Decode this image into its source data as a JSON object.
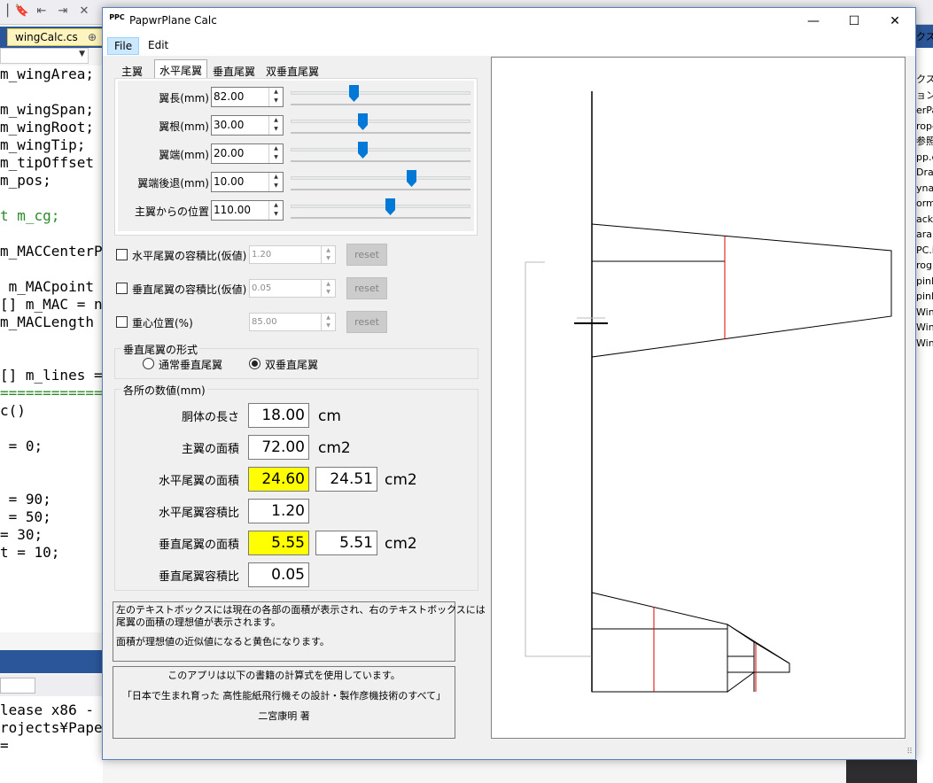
{
  "ide": {
    "tab_label": "wingCalc.cs",
    "tab_pin": "⊕",
    "code_lines": [
      "m_wingArea;",
      "",
      "m_wingSpan;",
      "m_wingRoot;",
      "m_wingTip;",
      "m_tipOffset",
      "m_pos;",
      "",
      "t m_cg;",
      "",
      "m_MACCenterP",
      "",
      " m_MACpoint",
      "[] m_MAC = n",
      "m_MACLength",
      "",
      "",
      "[] m_lines =",
      "============",
      "c()",
      "",
      " = 0;",
      "",
      "",
      " = 90;",
      " = 50;",
      "= 30;",
      "t = 10;"
    ],
    "output_lines": [
      "lease x86 -",
      "rojects¥Pape",
      "="
    ],
    "right_panel_items": [
      "クス",
      "クス",
      "ョン",
      "erPa",
      "rope",
      "参照",
      "pp.c",
      "Draw",
      "ynan",
      "orm",
      "ack",
      "aran",
      "PC.i",
      "rog",
      "pinB",
      "pinB",
      "Wing",
      "Wing",
      "Wing"
    ]
  },
  "app": {
    "icon_text": "PPC",
    "title": "PapwrPlane Calc",
    "window_controls": {
      "minimize": "—",
      "maximize": "☐",
      "close": "✕"
    },
    "menu": {
      "file": "File",
      "edit": "Edit"
    },
    "tabs": [
      "主翼",
      "水平尾翼",
      "垂直尾翼",
      "双垂直尾翼"
    ],
    "active_tab_index": 1,
    "params": [
      {
        "label": "翼長(mm)",
        "value": "82.00",
        "slider_fraction": 0.35
      },
      {
        "label": "翼根(mm)",
        "value": "30.00",
        "slider_fraction": 0.4
      },
      {
        "label": "翼端(mm)",
        "value": "20.00",
        "slider_fraction": 0.4
      },
      {
        "label": "翼端後退(mm)",
        "value": "10.00",
        "slider_fraction": 0.67
      },
      {
        "label": "主翼からの位置",
        "value": "110.00",
        "slider_fraction": 0.55
      }
    ],
    "options": [
      {
        "label": "水平尾翼の容積比(仮値)",
        "value": "1.20",
        "checked": false,
        "reset": "reset"
      },
      {
        "label": "垂直尾翼の容積比(仮値)",
        "value": "0.05",
        "checked": false,
        "reset": "reset"
      },
      {
        "label": "重心位置(%)",
        "value": "85.00",
        "checked": false,
        "reset": "reset"
      }
    ],
    "vtail_type": {
      "title": "垂直尾翼の形式",
      "options": [
        "通常垂直尾翼",
        "双垂直尾翼"
      ],
      "selected_index": 1
    },
    "results": {
      "title": "各所の数値(mm)",
      "fuselage_length": {
        "label": "胴体の長さ",
        "value": "18.00",
        "unit": "cm"
      },
      "main_wing_area": {
        "label": "主翼の面積",
        "value": "72.00",
        "unit": "cm2"
      },
      "htail_area": {
        "label": "水平尾翼の面積",
        "value": "24.60",
        "ideal": "24.51",
        "unit": "cm2",
        "highlight": "#ffff00"
      },
      "htail_volume": {
        "label": "水平尾翼容積比",
        "value": "1.20"
      },
      "vtail_area": {
        "label": "垂直尾翼の面積",
        "value": "5.55",
        "ideal": "5.51",
        "unit": "cm2",
        "highlight": "#ffff00"
      },
      "vtail_volume": {
        "label": "垂直尾翼容積比",
        "value": "0.05"
      }
    },
    "note": [
      "左のテキストボックスには現在の各部の面積が表示され、右のテキストボックスには",
      "尾翼の面積の理想値が表示されます。",
      "面積が理想値の近似値になると黄色になります。"
    ],
    "credits": [
      "このアプリは以下の書籍の計算式を使用しています。",
      "「日本で生まれ育った 高性能紙飛行機その設計・製作彦機技術のすべて」",
      "二宮康明 著"
    ],
    "grip": "⠿"
  },
  "colors": {
    "accent": "#0078d7",
    "highlight": "#ffff00",
    "mac_line": "#e00000"
  }
}
